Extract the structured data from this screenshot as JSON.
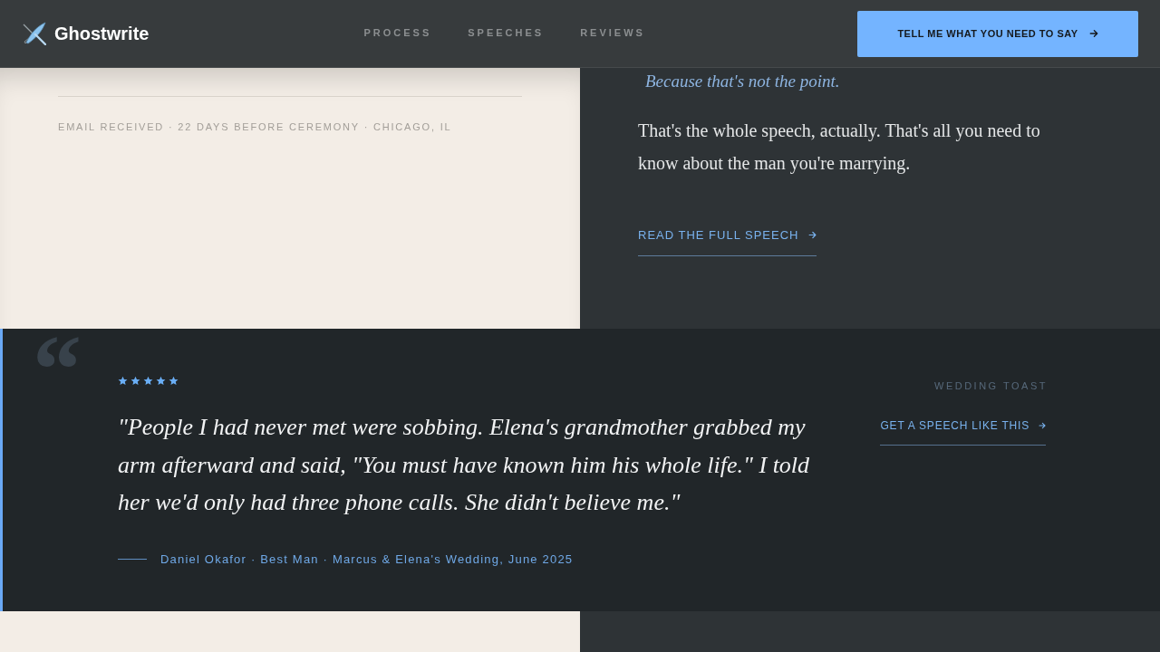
{
  "header": {
    "brand": "Ghostwrite",
    "nav": [
      {
        "label": "PROCESS"
      },
      {
        "label": "SPEECHES"
      },
      {
        "label": "REVIEWS"
      }
    ],
    "cta": "TELL ME WHAT YOU NEED TO SAY"
  },
  "email_panel": {
    "meta": "EMAIL RECEIVED · 22 DAYS BEFORE CEREMONY · CHICAGO, IL"
  },
  "speech_panel": {
    "pull_quote": "Because that's not the point.",
    "paragraph": "That's the whole speech, actually. That's all you need to know about the man you're marrying.",
    "link": "READ THE FULL SPEECH"
  },
  "testimonial": {
    "quote_glyph": "“",
    "stars": 5,
    "quote": "\"People I had never met were sobbing. Elena's grandmother grabbed my arm afterward and said, \"You must have known him his whole life.\" I told her we'd only had three phone calls. She didn't believe me.\"",
    "attribution": "Daniel Okafor · Best Man · Marcus & Elena's Wedding, June 2025",
    "category": "WEDDING TOAST",
    "link": "GET A SPEECH LIKE THIS"
  }
}
